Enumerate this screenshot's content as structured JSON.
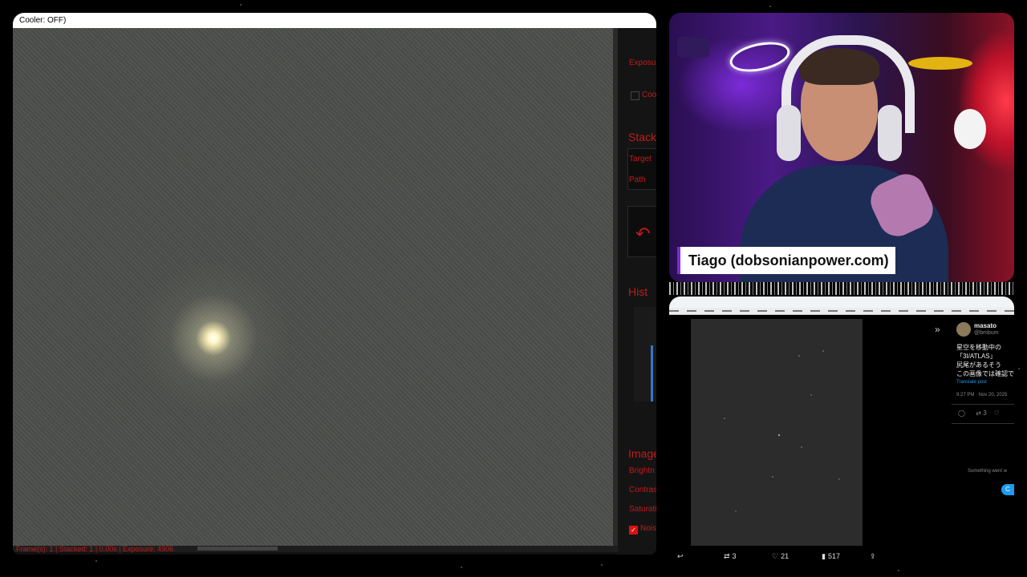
{
  "capture": {
    "title": "Cooler: OFF)",
    "status": "Frame(s): 1 | Stacked: 1 | 0.00s | Exposure: 4906",
    "panel": {
      "exposure_label": "Exposure",
      "cooler_label": "Coo",
      "stack_header": "Stack",
      "target_label": "Target",
      "path_label": "Path",
      "hist_header": "Hist",
      "image_header": "Image",
      "brightness_label": "Brightn",
      "contrast_label": "Contrast",
      "saturation_label": "Saturatio",
      "noise_label": "Nois",
      "undo_icon": "undo-arrow",
      "accent": "#c21b1b"
    }
  },
  "webcam": {
    "name": "Tiago (dobsonianpower.com)"
  },
  "browser": {
    "post": {
      "user": "masato",
      "handle": "@bmbum",
      "lines": [
        "星空を移動中の",
        "「3I/ATLAS」",
        "尻尾があるそう",
        "この画像では確認で"
      ],
      "translate": "Translate post",
      "time": "9:27 PM · Nov 20, 2025",
      "retweets": "3",
      "likes": "21",
      "views": "517",
      "side_retweets": "3",
      "error": "Something went w",
      "retry": "C"
    }
  },
  "colors": {
    "accent_red": "#c21b1b",
    "link_blue": "#1d9bf0"
  }
}
